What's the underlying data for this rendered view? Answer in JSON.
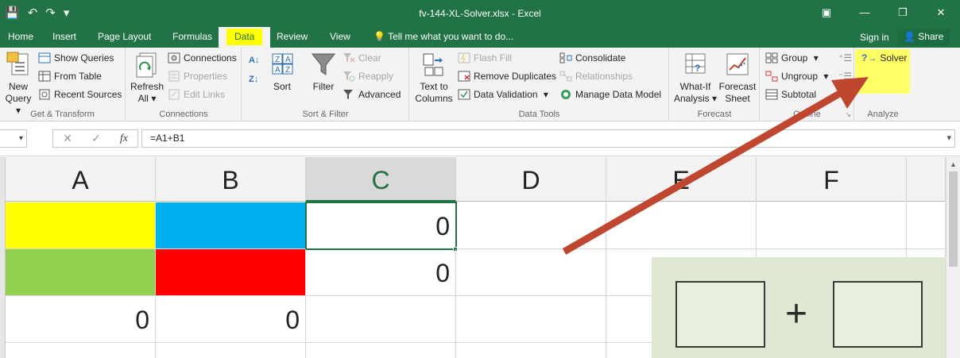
{
  "window": {
    "title": "fv-144-XL-Solver.xlsx - Excel",
    "controls": [
      "▣",
      "—",
      "❐",
      "✕"
    ]
  },
  "qat": {
    "save": "💾",
    "undo": "↶",
    "redo": "↷",
    "customize": "▾"
  },
  "tabs": [
    "Home",
    "Insert",
    "Page Layout",
    "Formulas",
    "Data",
    "Review",
    "View"
  ],
  "active_tab": "Data",
  "tell_me": "Tell me what you want to do...",
  "signin": "Sign in",
  "share": "Share",
  "ribbon": {
    "get_transform": {
      "label": "Get & Transform",
      "new_query": "New",
      "new_query2": "Query",
      "show_queries": "Show Queries",
      "from_table": "From Table",
      "recent_sources": "Recent Sources"
    },
    "connections": {
      "label": "Connections",
      "refresh": "Refresh",
      "refresh2": "All",
      "connections": "Connections",
      "properties": "Properties",
      "edit_links": "Edit Links"
    },
    "sort_filter": {
      "label": "Sort & Filter",
      "sort": "Sort",
      "filter": "Filter",
      "clear": "Clear",
      "reapply": "Reapply",
      "advanced": "Advanced"
    },
    "data_tools": {
      "label": "Data Tools",
      "text_to_columns": "Text to",
      "text_to_columns2": "Columns",
      "flash_fill": "Flash Fill",
      "remove_duplicates": "Remove Duplicates",
      "data_validation": "Data Validation",
      "consolidate": "Consolidate",
      "relationships": "Relationships",
      "manage_data_model": "Manage Data Model"
    },
    "forecast": {
      "label": "Forecast",
      "what_if": "What-If",
      "what_if2": "Analysis",
      "forecast_sheet": "Forecast",
      "forecast_sheet2": "Sheet"
    },
    "outline": {
      "label": "Outline",
      "group": "Group",
      "ungroup": "Ungroup",
      "subtotal": "Subtotal"
    },
    "analyze": {
      "label": "Analyze",
      "solver": "Solver"
    }
  },
  "formula_bar": {
    "name_box": "",
    "cancel": "✕",
    "enter": "✓",
    "fx": "fx",
    "formula": "=A1+B1"
  },
  "columns": [
    "A",
    "B",
    "C",
    "D",
    "E",
    "F"
  ],
  "selected_column": "C",
  "cells": {
    "C1": "0",
    "C2": "0",
    "A3": "0",
    "B3": "0"
  },
  "colors": {
    "excel_green": "#217346",
    "yellow": "#ffff00",
    "blue": "#00b0f0",
    "green": "#92d050",
    "red": "#ff0000",
    "arrow": "#c0472f"
  }
}
